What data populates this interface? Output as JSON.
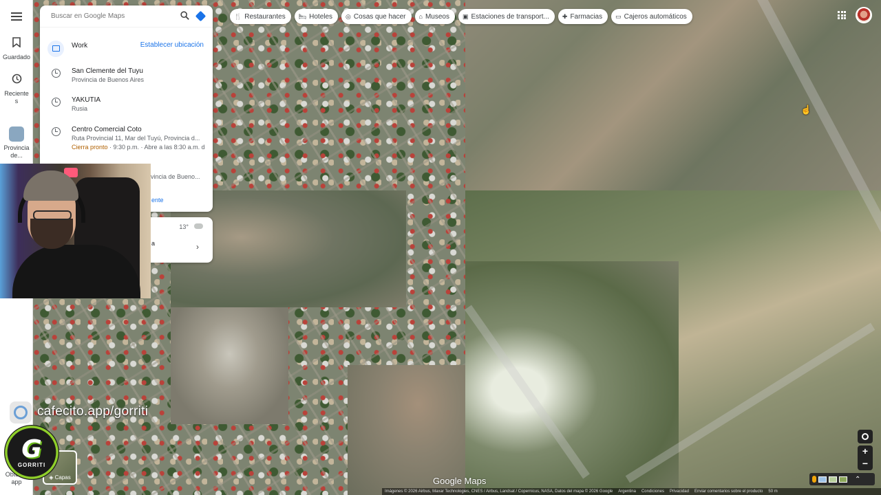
{
  "search": {
    "placeholder": "Buscar en Google Maps"
  },
  "rail": {
    "saved_label": "Guardado",
    "recent_label": "Reciente s",
    "recent_place_label": "Provincia de...",
    "get_app_label": "Obtener app"
  },
  "panel": {
    "work": {
      "title": "Work",
      "action": "Establecer ubicación"
    },
    "items": [
      {
        "title": "San Clemente del Tuyu",
        "subtitle": "Provincia de Buenos Aires"
      },
      {
        "title": "YAKUTIA",
        "subtitle": "Rusia"
      },
      {
        "title": "Centro Comercial Coto",
        "subtitle": "Ruta Provincial 11, Mar del Tuyú, Provincia d...",
        "status_warn": "Cierra pronto",
        "status_rest": " · 9:30 p.m. · Abre a las 8:30 a.m. d"
      },
      {
        "subtitle": "ovincia de Bueno..."
      }
    ],
    "more_link": "ente"
  },
  "weather": {
    "temp": "13°",
    "text": "a"
  },
  "chips": [
    {
      "icon": "fork-knife-icon",
      "glyph": "🍴",
      "label": "Restaurantes"
    },
    {
      "icon": "bed-icon",
      "glyph": "🛏",
      "label": "Hoteles"
    },
    {
      "icon": "camera-icon",
      "glyph": "◎",
      "label": "Cosas que hacer"
    },
    {
      "icon": "museum-icon",
      "glyph": "⌂",
      "label": "Museos"
    },
    {
      "icon": "transit-icon",
      "glyph": "▣",
      "label": "Estaciones de transport..."
    },
    {
      "icon": "pharmacy-icon",
      "glyph": "✚",
      "label": "Farmacias"
    },
    {
      "icon": "atm-icon",
      "glyph": "▭",
      "label": "Cajeros automáticos"
    }
  ],
  "overlay": {
    "cafecito": "cafecito.app/gorriti",
    "logo_letter": "G",
    "logo_text": "GORRITI"
  },
  "map": {
    "layers_label": "Capas",
    "brand": "Google Maps",
    "footer": [
      "Imágenes © 2026 Airbus, Maxar Technologies, CNES / Airbus, Landsat / Copernicus, NASA, Datos del mapa © 2026 Google",
      "Argentina",
      "Condiciones",
      "Privacidad",
      "Enviar comentarios sobre el producto",
      "50 m"
    ],
    "zoom_in": "+",
    "zoom_out": "−"
  },
  "colors": {
    "accent": "#1a73e8",
    "warn": "#b06000",
    "logo_green": "#8fcf2a"
  }
}
